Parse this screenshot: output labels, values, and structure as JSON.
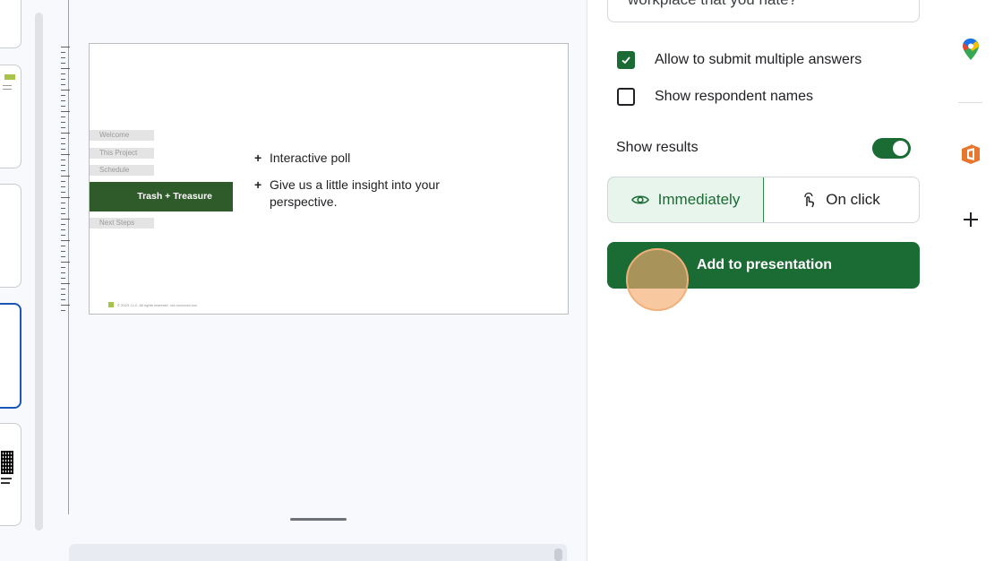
{
  "slide": {
    "agenda": [
      "Welcome",
      "This Project",
      "Schedule",
      "Next Steps"
    ],
    "active_section": "Trash + Treasure",
    "bullets": [
      "Interactive poll",
      "Give us a little insight into your perspective."
    ],
    "footer": "© 2023, LLC. All rights reserved. xxx.xxxxxxxx.xxx"
  },
  "panel": {
    "question_fragment": "workplace that you hate?",
    "option_multiple_answers": "Allow to submit multiple answers",
    "option_multiple_checked": true,
    "option_respondent_names": "Show respondent names",
    "option_respondent_checked": false,
    "show_results_label": "Show results",
    "show_results_on": true,
    "timing_options": [
      "Immediately",
      "On click"
    ],
    "timing_selected": "Immediately",
    "add_button": "Add to presentation"
  },
  "rail": {
    "icons": [
      "google-maps-icon",
      "office-icon",
      "plus-icon"
    ]
  },
  "colors": {
    "brand_green": "#1b6b35",
    "slide_green": "#2f5a2a",
    "active_blue": "#1a56b8"
  }
}
